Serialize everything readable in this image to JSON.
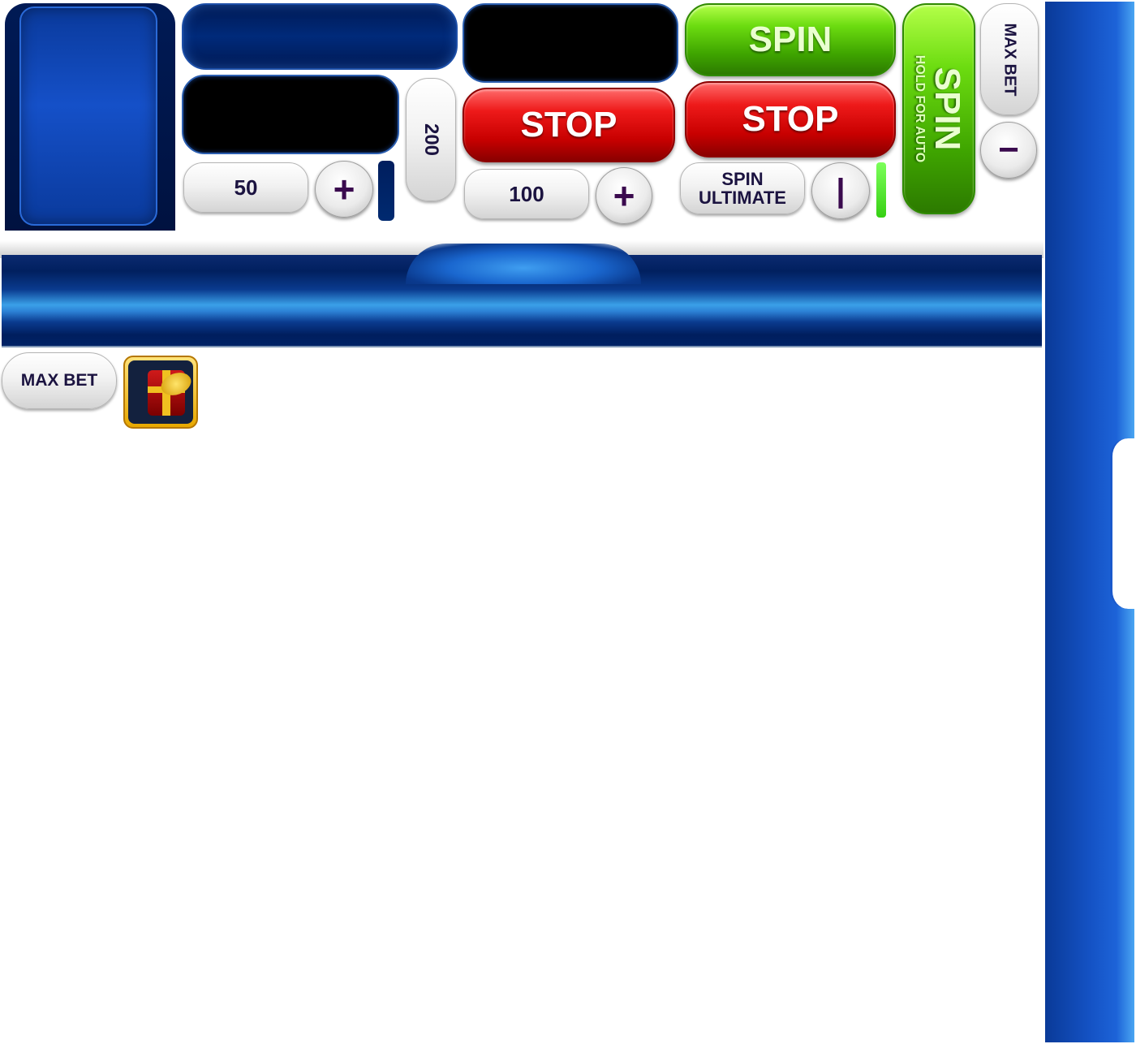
{
  "top_controls": {
    "bet_value_small": "50",
    "bet_value_mid": "100",
    "bet_value_vertical": "200",
    "plus_glyph": "+",
    "minus_glyph": "−",
    "stop_label_1": "STOP",
    "stop_label_2": "STOP",
    "spin_label": "SPIN",
    "spin_ultimate_line1": "SPIN",
    "spin_ultimate_line2": "ULTIMATE",
    "toggle_glyph": "|",
    "vertical_spin_label": "SPIN",
    "vertical_spin_sub": "HOLD FOR AUTO",
    "max_bet_vertical": "MAX BET"
  },
  "bottom_controls": {
    "max_bet_label": "MAX BET"
  },
  "icons": {
    "gift": "gift-box-icon",
    "plus": "plus-icon",
    "minus": "minus-icon"
  },
  "colors": {
    "panel_blue": "#0d47c0",
    "stop_red": "#e01010",
    "spin_green": "#5ccc08",
    "label_dark": "#1b1340"
  }
}
